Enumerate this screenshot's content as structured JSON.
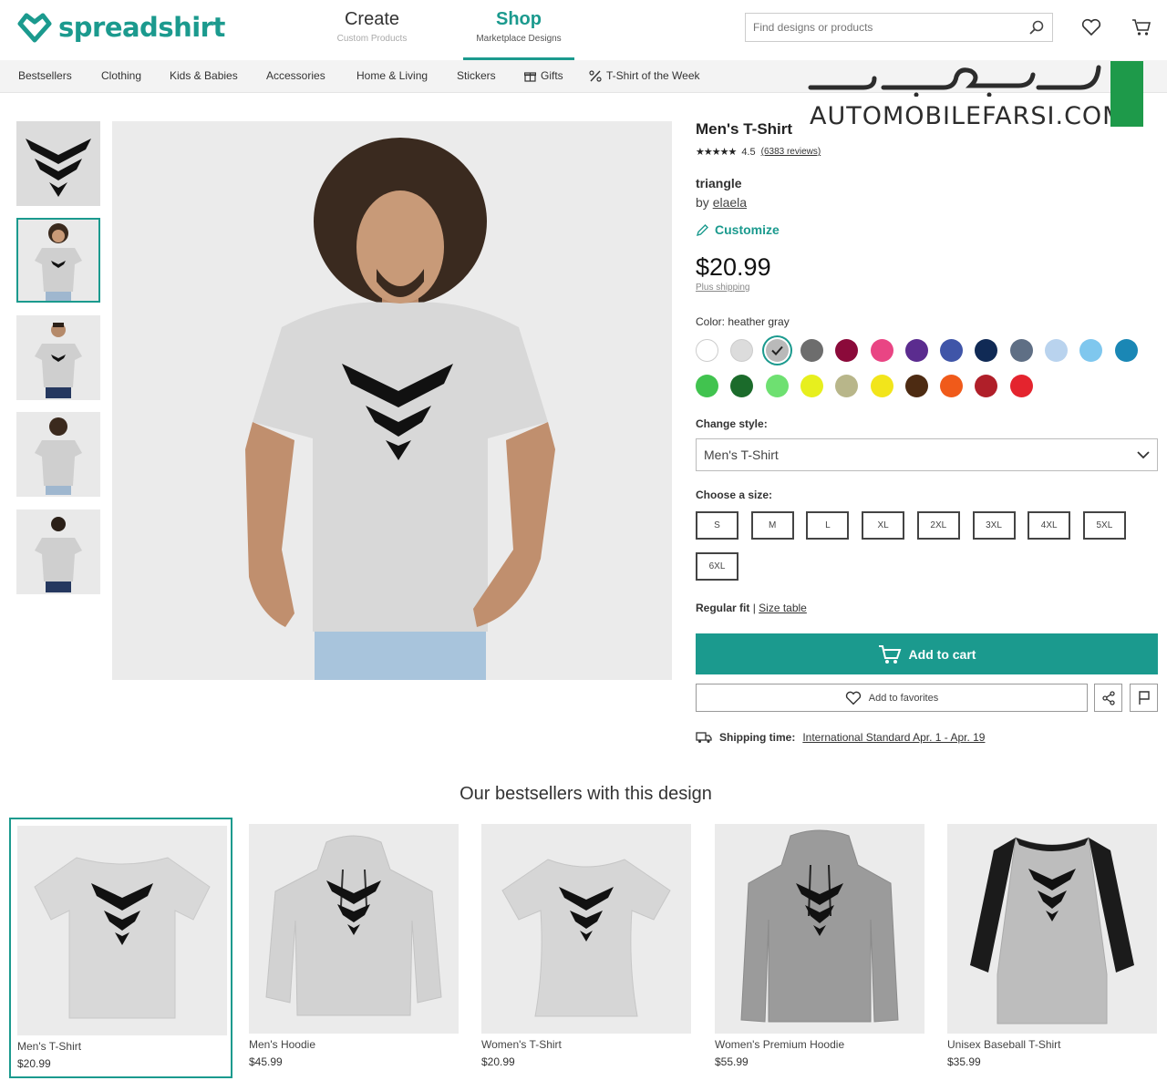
{
  "header": {
    "logo_text": "spreadshirt",
    "create": {
      "label": "Create",
      "sub": "Custom Products"
    },
    "shop": {
      "label": "Shop",
      "sub": "Marketplace Designs"
    },
    "search_placeholder": "Find designs or products"
  },
  "categories": [
    "Bestsellers",
    "Clothing",
    "Kids & Babies",
    "Accessories",
    "Home & Living",
    "Stickers",
    "Gifts",
    "T-Shirt of the Week"
  ],
  "watermark": {
    "text": "AUTOMOBILEFARSI.COM"
  },
  "product": {
    "title": "Men's T-Shirt",
    "stars": "★★★★★",
    "rating": "4.5",
    "reviews": "(6383 reviews)",
    "design_name": "triangle",
    "by_label": "by",
    "designer": "elaela",
    "customize": "Customize",
    "price": "$20.99",
    "shipping_note": "Plus shipping",
    "color_label": "Color: heather gray",
    "colors": [
      "#ffffff",
      "#dcdcdc",
      "#b9b9b9",
      "#6d6d6d",
      "#8b0a3a",
      "#e94584",
      "#5b2c8f",
      "#3f55a8",
      "#102a55",
      "#5f6f85",
      "#b9d3ee",
      "#7fc7ee",
      "#1a87b5",
      "#41c34f",
      "#1b6b2b",
      "#6ee071",
      "#e7ef1e",
      "#b8b68a",
      "#f2e51b",
      "#4d2b12",
      "#f05a1a",
      "#b01f29",
      "#e4242e"
    ],
    "style_label": "Change style:",
    "style_value": "Men's T-Shirt",
    "size_label": "Choose a size:",
    "sizes": [
      "S",
      "M",
      "L",
      "XL",
      "2XL",
      "3XL",
      "4XL",
      "5XL",
      "6XL"
    ],
    "fit": "Regular fit",
    "fit_sep": "|",
    "size_table": "Size table",
    "add_to_cart": "Add to cart",
    "add_to_favorites": "Add to favorites",
    "shipping_label": "Shipping time:",
    "shipping_value": "International Standard Apr. 1 - Apr. 19"
  },
  "bestsellers": {
    "title": "Our bestsellers with this design",
    "items": [
      {
        "name": "Men's T-Shirt",
        "price": "$20.99"
      },
      {
        "name": "Men's Hoodie",
        "price": "$45.99"
      },
      {
        "name": "Women's T-Shirt",
        "price": "$20.99"
      },
      {
        "name": "Women's Premium Hoodie",
        "price": "$55.99"
      },
      {
        "name": "Unisex Baseball T-Shirt",
        "price": "$35.99"
      }
    ]
  }
}
